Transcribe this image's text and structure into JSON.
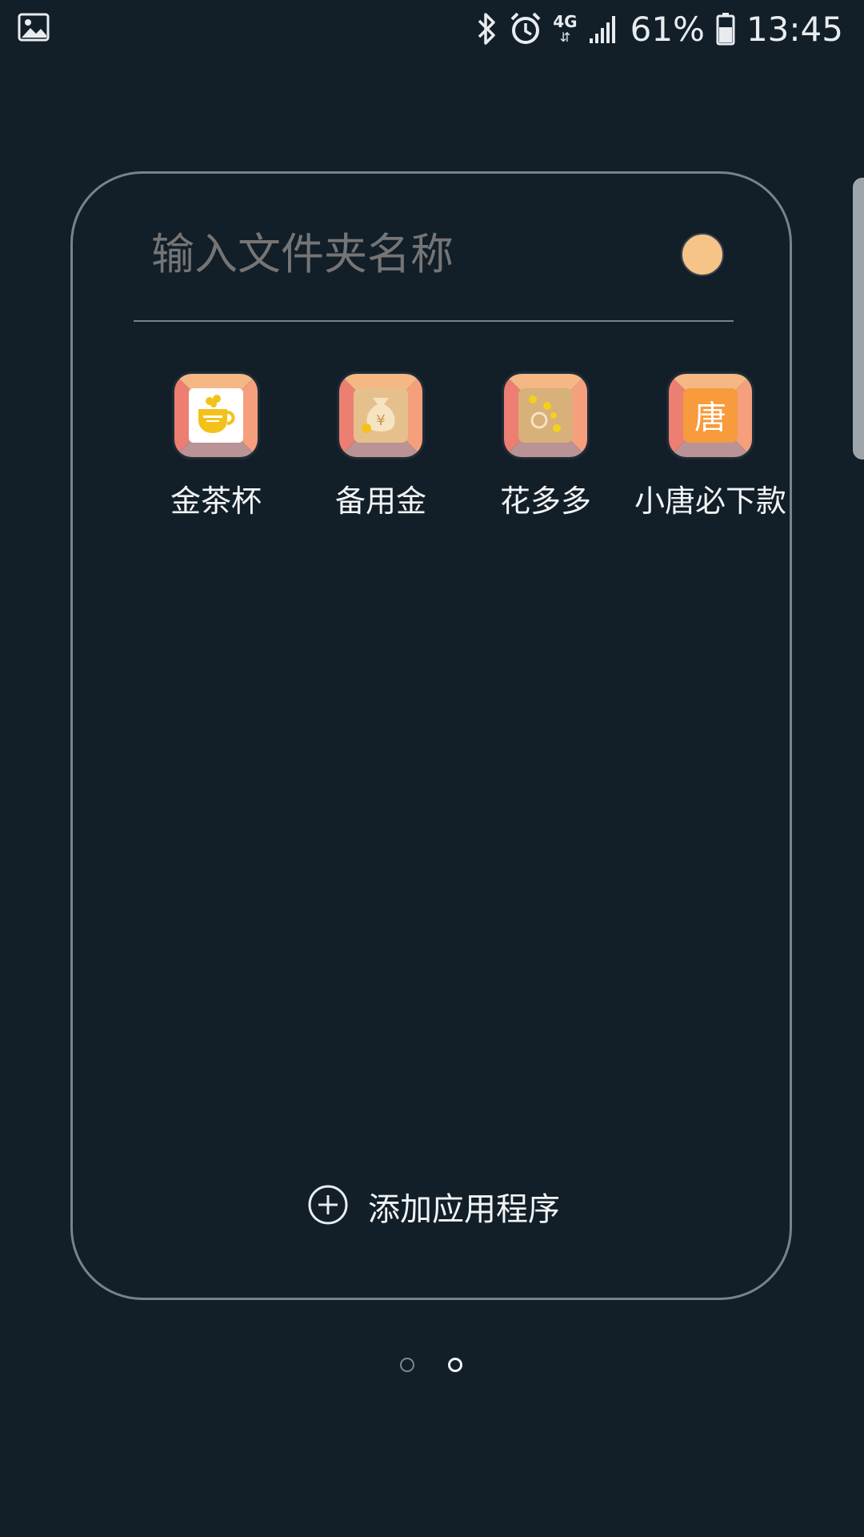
{
  "status_bar": {
    "network": "4G",
    "battery": "61%",
    "time": "13:45",
    "icons": [
      "image-icon",
      "bluetooth-icon",
      "alarm-icon",
      "data-arrows-icon",
      "signal-icon",
      "battery-icon"
    ]
  },
  "folder": {
    "name_placeholder": "输入文件夹名称",
    "color": "#f7c488",
    "apps": [
      {
        "label": "金茶杯",
        "icon": "golden-cup-icon"
      },
      {
        "label": "备用金",
        "icon": "money-bag-icon"
      },
      {
        "label": "花多多",
        "icon": "coins-icon"
      },
      {
        "label": "小唐必下款",
        "icon": "tang-character-icon",
        "glyph": "唐"
      }
    ],
    "add_apps_label": "添加应用程序"
  },
  "pager": {
    "current_page": 2,
    "total_pages": 2
  }
}
